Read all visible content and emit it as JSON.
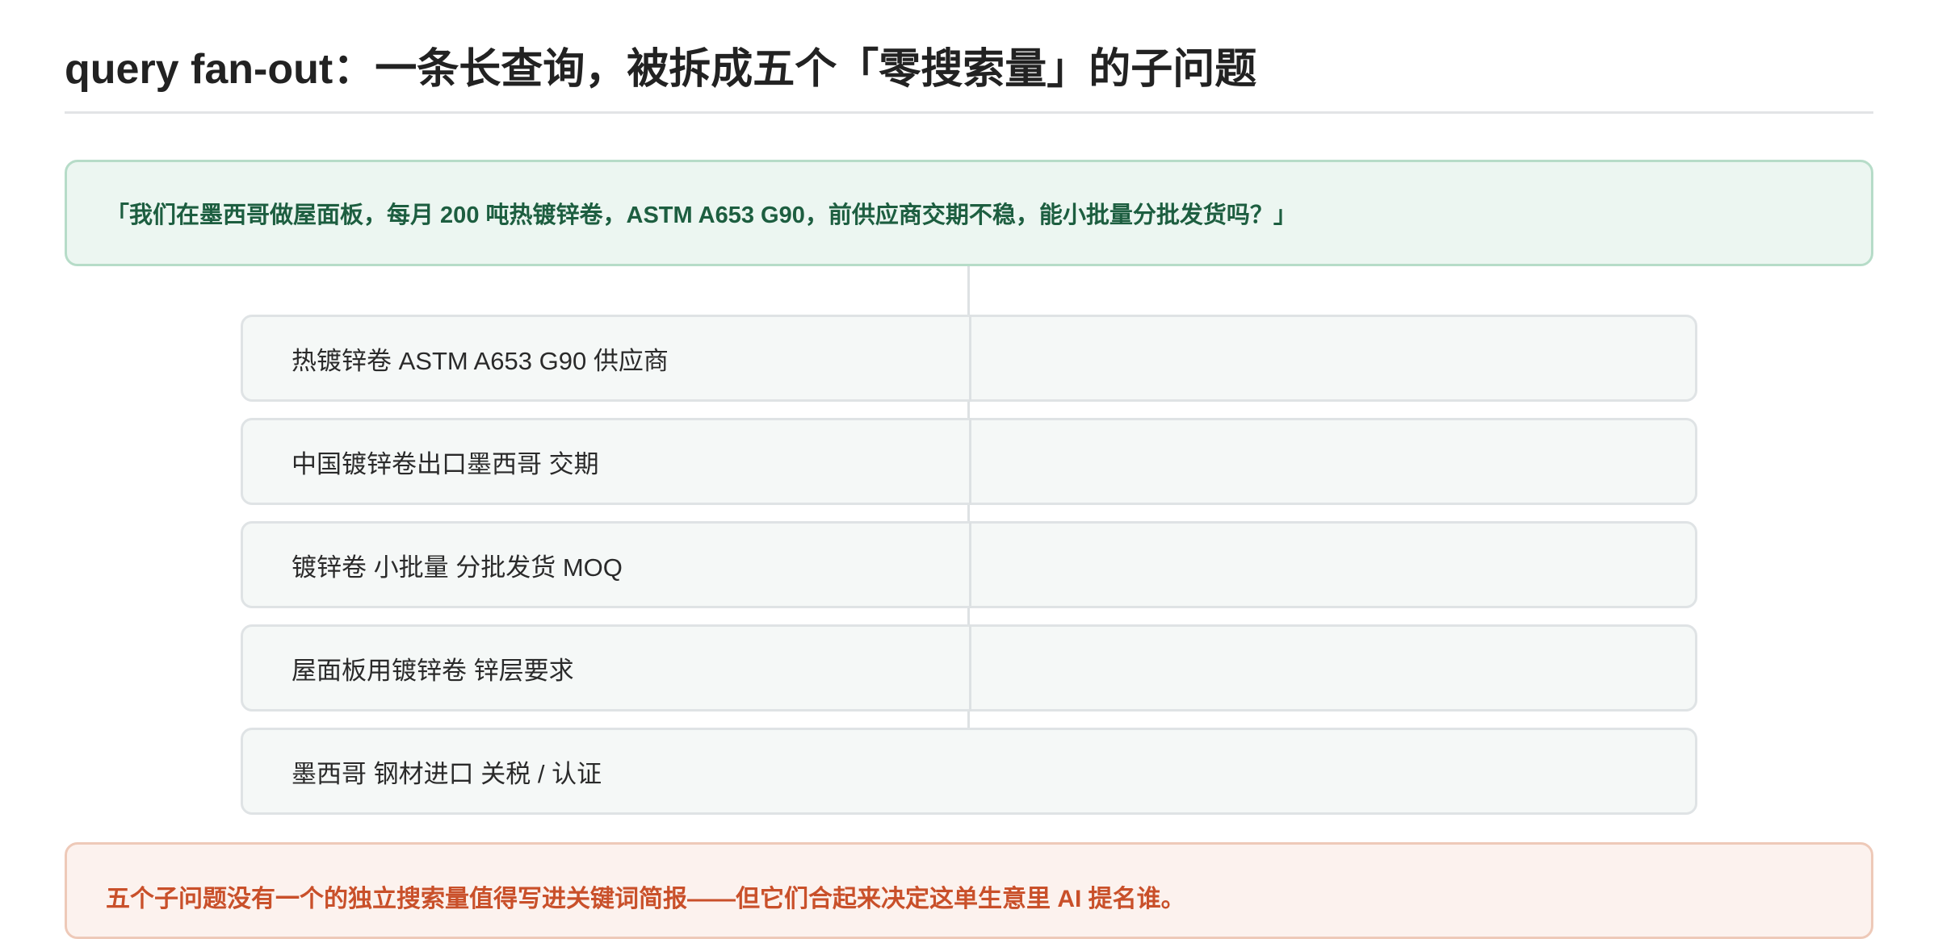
{
  "title": "query fan-out：一条长查询，被拆成五个「零搜索量」的子问题",
  "query": "「我们在墨西哥做屋面板，每月 200 吨热镀锌卷，ASTM A653 G90，前供应商交期不稳，能小批量分批发货吗？」",
  "sub_queries": [
    "热镀锌卷 ASTM A653 G90 供应商",
    "中国镀锌卷出口墨西哥 交期",
    "镀锌卷 小批量 分批发货 MOQ",
    "屋面板用镀锌卷 锌层要求",
    "墨西哥 钢材进口 关税 / 认证"
  ],
  "note": "五个子问题没有一个的独立搜索量值得写进关键词简报——但它们合起来决定这单生意里 AI 提名谁。",
  "colors": {
    "query_bg": "#ecf6f1",
    "query_border": "#b6dcc8",
    "query_text": "#1d5e40",
    "sub_bg": "#f5f8f7",
    "sub_border": "#dfe3e5",
    "note_bg": "#fcf2ee",
    "note_border": "#eec9b8",
    "note_text": "#c9502a"
  }
}
